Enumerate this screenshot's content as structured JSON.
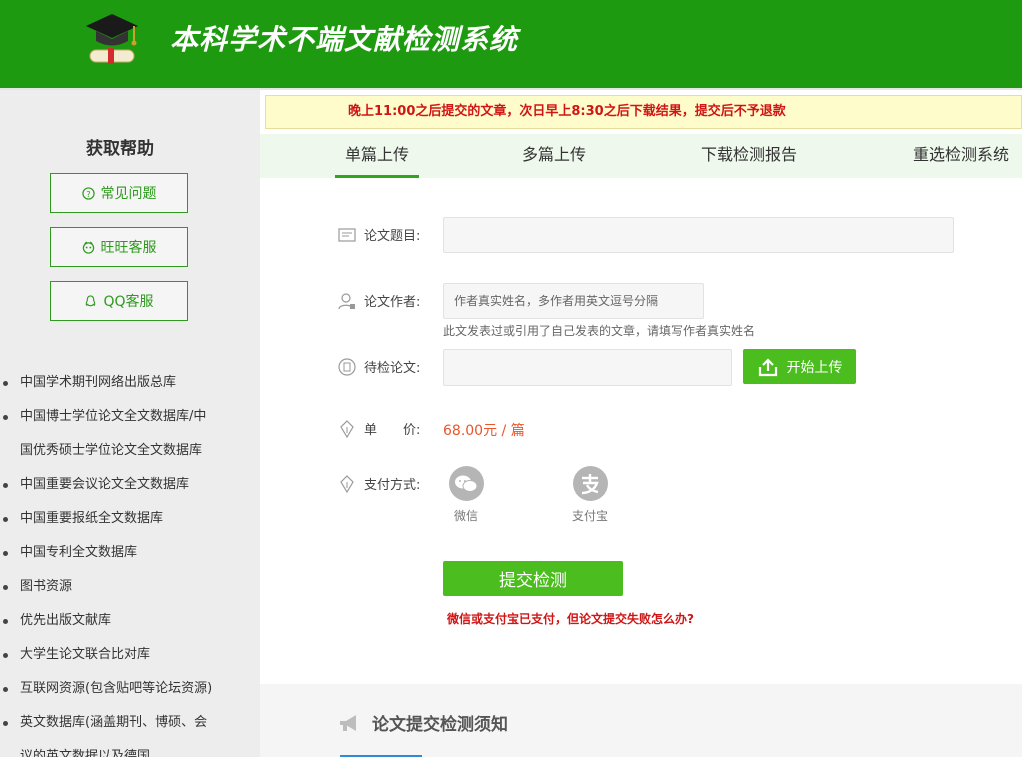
{
  "header": {
    "title": "本科学术不端文献检测系统"
  },
  "sidebar": {
    "help_title": "获取帮助",
    "help_buttons": [
      {
        "label": "常见问题",
        "icon": "question-circle-icon"
      },
      {
        "label": "旺旺客服",
        "icon": "wangwang-icon"
      },
      {
        "label": "QQ客服",
        "icon": "qq-icon"
      }
    ],
    "databases": [
      "中国学术期刊网络出版总库",
      "中国博士学位论文全文数据库/中",
      "国优秀硕士学位论文全文数据库",
      "中国重要会议论文全文数据库",
      "中国重要报纸全文数据库",
      "中国专利全文数据库",
      "图书资源",
      "优先出版文献库",
      "大学生论文联合比对库",
      "互联网资源(包含贴吧等论坛资源)",
      "英文数据库(涵盖期刊、博硕、会",
      "议的英文数据以及德国"
    ]
  },
  "notice": {
    "text": "晚上11:00之后提交的文章，次日早上8:30之后下载结果，提交后不予退款"
  },
  "tabs": [
    {
      "label": "单篇上传",
      "active": true
    },
    {
      "label": "多篇上传",
      "active": false
    },
    {
      "label": "下载检测报告",
      "active": false
    },
    {
      "label": "重选检测系统",
      "active": false
    }
  ],
  "form": {
    "title_label": "论文题目:",
    "title_value": "",
    "author_label": "论文作者:",
    "author_placeholder": "作者真实姓名，多作者用英文逗号分隔",
    "author_hint": "此文发表过或引用了自己发表的文章，请填写作者真实姓名",
    "file_label": "待检论文:",
    "upload_label": "开始上传",
    "price_label": "单　　价:",
    "price_value": "68.00元 / 篇",
    "pay_label": "支付方式:",
    "pay_options": [
      {
        "label": "微信",
        "icon": "wechat-icon"
      },
      {
        "label": "支付宝",
        "icon": "alipay-icon"
      }
    ],
    "submit_label": "提交检测",
    "fail_link": "微信或支付宝已支付，但论文提交失败怎么办?"
  },
  "notes": {
    "title": "论文提交检测须知"
  },
  "colors": {
    "header_green": "#1e9a10",
    "button_green": "#4bbd1e",
    "notice_red": "#d11515",
    "price_orange": "#e8562a"
  }
}
